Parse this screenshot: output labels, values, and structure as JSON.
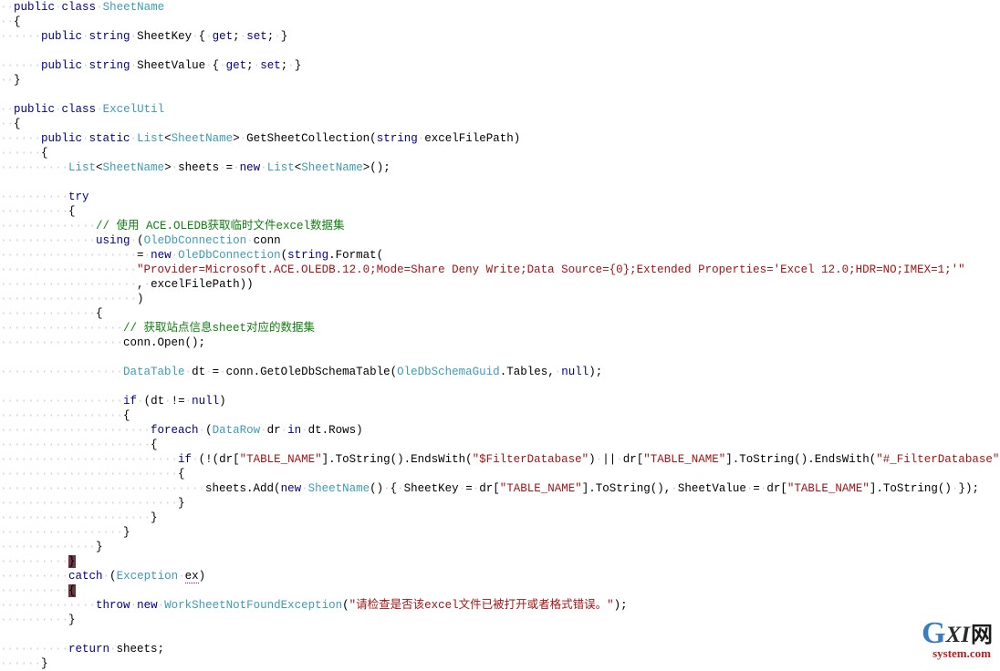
{
  "editor": {
    "language": "C#",
    "background_color": "#ffffff",
    "font_size_px": 12.5,
    "line_height_px": 16,
    "show_whitespace_dots": true,
    "colors": {
      "text": "#000000",
      "keyword": "#00008c",
      "type": "#3d9bb5",
      "string": "#a31515",
      "comment": "#108010",
      "whitespace_dot": "#c8d4d8",
      "brace_match_highlight_bg": "#6a3540"
    }
  },
  "watermark": {
    "logo_g": "G",
    "logo_xi": "XI",
    "logo_cn": "网",
    "domain": "system.com",
    "g_color": "#3a7cc0",
    "domain_color": "#b42020"
  },
  "code_lines": [
    {
      "indent": 2,
      "tokens": [
        {
          "t": "kw",
          "v": "public"
        },
        {
          "t": "ws",
          "v": "·"
        },
        {
          "t": "kw",
          "v": "class"
        },
        {
          "t": "ws",
          "v": "·"
        },
        {
          "t": "type",
          "v": "SheetName"
        }
      ]
    },
    {
      "indent": 2,
      "tokens": [
        {
          "t": "plain",
          "v": "{"
        }
      ]
    },
    {
      "indent": 6,
      "tokens": [
        {
          "t": "kw",
          "v": "public"
        },
        {
          "t": "ws",
          "v": "·"
        },
        {
          "t": "kw",
          "v": "string"
        },
        {
          "t": "ws",
          "v": "·"
        },
        {
          "t": "plain",
          "v": "SheetKey"
        },
        {
          "t": "ws",
          "v": "·"
        },
        {
          "t": "plain",
          "v": "{"
        },
        {
          "t": "ws",
          "v": "·"
        },
        {
          "t": "kw",
          "v": "get"
        },
        {
          "t": "plain",
          "v": ";"
        },
        {
          "t": "ws",
          "v": "·"
        },
        {
          "t": "kw",
          "v": "set"
        },
        {
          "t": "plain",
          "v": ";"
        },
        {
          "t": "ws",
          "v": "·"
        },
        {
          "t": "plain",
          "v": "}"
        }
      ]
    },
    {
      "indent": 0,
      "tokens": []
    },
    {
      "indent": 6,
      "tokens": [
        {
          "t": "kw",
          "v": "public"
        },
        {
          "t": "ws",
          "v": "·"
        },
        {
          "t": "kw",
          "v": "string"
        },
        {
          "t": "ws",
          "v": "·"
        },
        {
          "t": "plain",
          "v": "SheetValue"
        },
        {
          "t": "ws",
          "v": "·"
        },
        {
          "t": "plain",
          "v": "{"
        },
        {
          "t": "ws",
          "v": "·"
        },
        {
          "t": "kw",
          "v": "get"
        },
        {
          "t": "plain",
          "v": ";"
        },
        {
          "t": "ws",
          "v": "·"
        },
        {
          "t": "kw",
          "v": "set"
        },
        {
          "t": "plain",
          "v": ";"
        },
        {
          "t": "ws",
          "v": "·"
        },
        {
          "t": "plain",
          "v": "}"
        }
      ]
    },
    {
      "indent": 2,
      "tokens": [
        {
          "t": "plain",
          "v": "}"
        }
      ]
    },
    {
      "indent": 0,
      "tokens": []
    },
    {
      "indent": 2,
      "tokens": [
        {
          "t": "kw",
          "v": "public"
        },
        {
          "t": "ws",
          "v": "·"
        },
        {
          "t": "kw",
          "v": "class"
        },
        {
          "t": "ws",
          "v": "·"
        },
        {
          "t": "type",
          "v": "ExcelUtil"
        }
      ]
    },
    {
      "indent": 2,
      "tokens": [
        {
          "t": "plain",
          "v": "{"
        }
      ]
    },
    {
      "indent": 6,
      "tokens": [
        {
          "t": "kw",
          "v": "public"
        },
        {
          "t": "ws",
          "v": "·"
        },
        {
          "t": "kw",
          "v": "static"
        },
        {
          "t": "ws",
          "v": "·"
        },
        {
          "t": "type",
          "v": "List"
        },
        {
          "t": "plain",
          "v": "<"
        },
        {
          "t": "type",
          "v": "SheetName"
        },
        {
          "t": "plain",
          "v": ">"
        },
        {
          "t": "ws",
          "v": "·"
        },
        {
          "t": "plain",
          "v": "GetSheetCollection("
        },
        {
          "t": "kw",
          "v": "string"
        },
        {
          "t": "ws",
          "v": "·"
        },
        {
          "t": "plain",
          "v": "excelFilePath)"
        }
      ]
    },
    {
      "indent": 6,
      "tokens": [
        {
          "t": "plain",
          "v": "{"
        }
      ]
    },
    {
      "indent": 10,
      "tokens": [
        {
          "t": "type",
          "v": "List"
        },
        {
          "t": "plain",
          "v": "<"
        },
        {
          "t": "type",
          "v": "SheetName"
        },
        {
          "t": "plain",
          "v": ">"
        },
        {
          "t": "ws",
          "v": "·"
        },
        {
          "t": "plain",
          "v": "sheets"
        },
        {
          "t": "ws",
          "v": "·"
        },
        {
          "t": "plain",
          "v": "="
        },
        {
          "t": "ws",
          "v": "·"
        },
        {
          "t": "kw",
          "v": "new"
        },
        {
          "t": "ws",
          "v": "·"
        },
        {
          "t": "type",
          "v": "List"
        },
        {
          "t": "plain",
          "v": "<"
        },
        {
          "t": "type",
          "v": "SheetName"
        },
        {
          "t": "plain",
          "v": ">();"
        }
      ]
    },
    {
      "indent": 0,
      "tokens": []
    },
    {
      "indent": 10,
      "tokens": [
        {
          "t": "kw",
          "v": "try"
        }
      ]
    },
    {
      "indent": 10,
      "tokens": [
        {
          "t": "plain",
          "v": "{"
        }
      ]
    },
    {
      "indent": 14,
      "tokens": [
        {
          "t": "cmt",
          "v": "// 使用 ACE.OLEDB获取临时文件excel数据集"
        }
      ]
    },
    {
      "indent": 14,
      "tokens": [
        {
          "t": "kw",
          "v": "using"
        },
        {
          "t": "ws",
          "v": "·"
        },
        {
          "t": "plain",
          "v": "("
        },
        {
          "t": "type",
          "v": "OleDbConnection"
        },
        {
          "t": "ws",
          "v": "·"
        },
        {
          "t": "plain",
          "v": "conn"
        }
      ]
    },
    {
      "indent": 20,
      "tokens": [
        {
          "t": "plain",
          "v": "="
        },
        {
          "t": "ws",
          "v": "·"
        },
        {
          "t": "kw",
          "v": "new"
        },
        {
          "t": "ws",
          "v": "·"
        },
        {
          "t": "type",
          "v": "OleDbConnection"
        },
        {
          "t": "plain",
          "v": "("
        },
        {
          "t": "kw",
          "v": "string"
        },
        {
          "t": "plain",
          "v": ".Format("
        }
      ]
    },
    {
      "indent": 20,
      "tokens": [
        {
          "t": "str",
          "v": "\"Provider=Microsoft.ACE.OLEDB.12.0;Mode=Share Deny Write;Data Source={0};Extended Properties='Excel 12.0;HDR=NO;IMEX=1;'\""
        }
      ]
    },
    {
      "indent": 20,
      "tokens": [
        {
          "t": "plain",
          "v": ","
        },
        {
          "t": "ws",
          "v": "·"
        },
        {
          "t": "plain",
          "v": "excelFilePath))"
        }
      ]
    },
    {
      "indent": 20,
      "tokens": [
        {
          "t": "plain",
          "v": ")"
        }
      ]
    },
    {
      "indent": 14,
      "tokens": [
        {
          "t": "plain",
          "v": "{"
        }
      ]
    },
    {
      "indent": 18,
      "tokens": [
        {
          "t": "cmt",
          "v": "// 获取站点信息sheet对应的数据集"
        }
      ]
    },
    {
      "indent": 18,
      "tokens": [
        {
          "t": "plain",
          "v": "conn.Open();"
        }
      ]
    },
    {
      "indent": 0,
      "tokens": []
    },
    {
      "indent": 18,
      "tokens": [
        {
          "t": "type",
          "v": "DataTable"
        },
        {
          "t": "ws",
          "v": "·"
        },
        {
          "t": "plain",
          "v": "dt"
        },
        {
          "t": "ws",
          "v": "·"
        },
        {
          "t": "plain",
          "v": "="
        },
        {
          "t": "ws",
          "v": "·"
        },
        {
          "t": "plain",
          "v": "conn.GetOleDbSchemaTable("
        },
        {
          "t": "type",
          "v": "OleDbSchemaGuid"
        },
        {
          "t": "plain",
          "v": ".Tables,"
        },
        {
          "t": "ws",
          "v": "·"
        },
        {
          "t": "kw",
          "v": "null"
        },
        {
          "t": "plain",
          "v": ");"
        }
      ]
    },
    {
      "indent": 0,
      "tokens": []
    },
    {
      "indent": 18,
      "tokens": [
        {
          "t": "kw",
          "v": "if"
        },
        {
          "t": "ws",
          "v": "·"
        },
        {
          "t": "plain",
          "v": "(dt"
        },
        {
          "t": "ws",
          "v": "·"
        },
        {
          "t": "plain",
          "v": "!="
        },
        {
          "t": "ws",
          "v": "·"
        },
        {
          "t": "kw",
          "v": "null"
        },
        {
          "t": "plain",
          "v": ")"
        }
      ]
    },
    {
      "indent": 18,
      "tokens": [
        {
          "t": "plain",
          "v": "{"
        }
      ]
    },
    {
      "indent": 22,
      "tokens": [
        {
          "t": "kw",
          "v": "foreach"
        },
        {
          "t": "ws",
          "v": "·"
        },
        {
          "t": "plain",
          "v": "("
        },
        {
          "t": "type",
          "v": "DataRow"
        },
        {
          "t": "ws",
          "v": "·"
        },
        {
          "t": "plain",
          "v": "dr"
        },
        {
          "t": "ws",
          "v": "·"
        },
        {
          "t": "kw",
          "v": "in"
        },
        {
          "t": "ws",
          "v": "·"
        },
        {
          "t": "plain",
          "v": "dt.Rows)"
        }
      ]
    },
    {
      "indent": 22,
      "tokens": [
        {
          "t": "plain",
          "v": "{"
        }
      ]
    },
    {
      "indent": 26,
      "tokens": [
        {
          "t": "kw",
          "v": "if"
        },
        {
          "t": "ws",
          "v": "·"
        },
        {
          "t": "plain",
          "v": "(!(dr["
        },
        {
          "t": "str",
          "v": "\"TABLE_NAME\""
        },
        {
          "t": "plain",
          "v": "].ToString().EndsWith("
        },
        {
          "t": "str",
          "v": "\"$FilterDatabase\""
        },
        {
          "t": "plain",
          "v": ")"
        },
        {
          "t": "ws",
          "v": "·"
        },
        {
          "t": "plain",
          "v": "||"
        },
        {
          "t": "ws",
          "v": "·"
        },
        {
          "t": "plain",
          "v": "dr["
        },
        {
          "t": "str",
          "v": "\"TABLE_NAME\""
        },
        {
          "t": "plain",
          "v": "].ToString().EndsWith("
        },
        {
          "t": "str",
          "v": "\"#_FilterDatabase\""
        },
        {
          "t": "plain",
          "v": ")))"
        }
      ]
    },
    {
      "indent": 26,
      "tokens": [
        {
          "t": "plain",
          "v": "{"
        }
      ]
    },
    {
      "indent": 30,
      "tokens": [
        {
          "t": "plain",
          "v": "sheets.Add("
        },
        {
          "t": "kw",
          "v": "new"
        },
        {
          "t": "ws",
          "v": "·"
        },
        {
          "t": "type",
          "v": "SheetName"
        },
        {
          "t": "plain",
          "v": "()"
        },
        {
          "t": "ws",
          "v": "·"
        },
        {
          "t": "plain",
          "v": "{"
        },
        {
          "t": "ws",
          "v": "·"
        },
        {
          "t": "plain",
          "v": "SheetKey"
        },
        {
          "t": "ws",
          "v": "·"
        },
        {
          "t": "plain",
          "v": "="
        },
        {
          "t": "ws",
          "v": "·"
        },
        {
          "t": "plain",
          "v": "dr["
        },
        {
          "t": "str",
          "v": "\"TABLE_NAME\""
        },
        {
          "t": "plain",
          "v": "].ToString(),"
        },
        {
          "t": "ws",
          "v": "·"
        },
        {
          "t": "plain",
          "v": "SheetValue"
        },
        {
          "t": "ws",
          "v": "·"
        },
        {
          "t": "plain",
          "v": "="
        },
        {
          "t": "ws",
          "v": "·"
        },
        {
          "t": "plain",
          "v": "dr["
        },
        {
          "t": "str",
          "v": "\"TABLE_NAME\""
        },
        {
          "t": "plain",
          "v": "].ToString()"
        },
        {
          "t": "ws",
          "v": "·"
        },
        {
          "t": "plain",
          "v": "});"
        }
      ]
    },
    {
      "indent": 26,
      "tokens": [
        {
          "t": "plain",
          "v": "}"
        }
      ]
    },
    {
      "indent": 22,
      "tokens": [
        {
          "t": "plain",
          "v": "}"
        }
      ]
    },
    {
      "indent": 18,
      "tokens": [
        {
          "t": "plain",
          "v": "}"
        }
      ]
    },
    {
      "indent": 14,
      "tokens": [
        {
          "t": "plain",
          "v": "}"
        }
      ]
    },
    {
      "indent": 10,
      "tokens": [
        {
          "t": "brace",
          "v": "}"
        }
      ]
    },
    {
      "indent": 10,
      "tokens": [
        {
          "t": "kw",
          "v": "catch"
        },
        {
          "t": "ws",
          "v": "·"
        },
        {
          "t": "plain",
          "v": "("
        },
        {
          "t": "type",
          "v": "Exception"
        },
        {
          "t": "ws",
          "v": "·"
        },
        {
          "t": "err",
          "v": "ex"
        },
        {
          "t": "plain",
          "v": ")"
        }
      ]
    },
    {
      "indent": 10,
      "tokens": [
        {
          "t": "brace",
          "v": "{"
        }
      ]
    },
    {
      "indent": 14,
      "tokens": [
        {
          "t": "kw",
          "v": "throw"
        },
        {
          "t": "ws",
          "v": "·"
        },
        {
          "t": "kw",
          "v": "new"
        },
        {
          "t": "ws",
          "v": "·"
        },
        {
          "t": "type",
          "v": "WorkSheetNotFoundException"
        },
        {
          "t": "plain",
          "v": "("
        },
        {
          "t": "str",
          "v": "\"请检查是否该excel文件已被打开或者格式错误。\""
        },
        {
          "t": "plain",
          "v": ");"
        }
      ]
    },
    {
      "indent": 10,
      "tokens": [
        {
          "t": "plain",
          "v": "}"
        }
      ]
    },
    {
      "indent": 0,
      "tokens": []
    },
    {
      "indent": 10,
      "tokens": [
        {
          "t": "kw",
          "v": "return"
        },
        {
          "t": "ws",
          "v": "·"
        },
        {
          "t": "plain",
          "v": "sheets;"
        }
      ]
    },
    {
      "indent": 6,
      "tokens": [
        {
          "t": "plain",
          "v": "}"
        }
      ]
    }
  ]
}
